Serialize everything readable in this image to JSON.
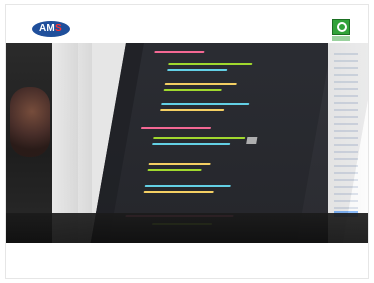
{
  "header": {
    "left_logo": {
      "text_primary": "AM",
      "text_accent": "S",
      "primary_color": "#1f4f9b",
      "accent_color": "#ff2f2f"
    },
    "right_logo": {
      "icon": "badge-icon",
      "color": "#31a33a"
    }
  },
  "video": {
    "scene": "code-editor-on-monitor"
  }
}
